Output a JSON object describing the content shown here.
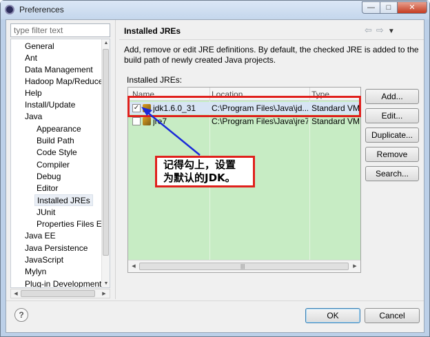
{
  "window": {
    "title": "Preferences",
    "min_glyph": "—",
    "max_glyph": "□",
    "close_glyph": "✕"
  },
  "left": {
    "filter_placeholder": "type filter text",
    "tree": [
      "General",
      "Ant",
      "Data Management",
      "Hadoop Map/Reduce",
      "Help",
      "Install/Update",
      "Java",
      "Appearance",
      "Build Path",
      "Code Style",
      "Compiler",
      "Debug",
      "Editor",
      "Installed JREs",
      "JUnit",
      "Properties Files Ed",
      "Java EE",
      "Java Persistence",
      "JavaScript",
      "Mylyn",
      "Plug-in Development"
    ],
    "selected": "Installed JREs"
  },
  "page": {
    "title": "Installed JREs",
    "description": "Add, remove or edit JRE definitions. By default, the checked JRE is added to the build path of newly created Java projects.",
    "table_label": "Installed JREs:",
    "columns": [
      "Name",
      "Location",
      "Type"
    ],
    "rows": [
      {
        "checked": true,
        "name": "jdk1.6.0_31",
        "location": "C:\\Program Files\\Java\\jd...",
        "type": "Standard VM"
      },
      {
        "checked": false,
        "name": "jre7",
        "location": "C:\\Program Files\\Java\\jre7",
        "type": "Standard VM"
      }
    ],
    "buttons": {
      "add": "Add...",
      "edit": "Edit...",
      "duplicate": "Duplicate...",
      "remove": "Remove",
      "search": "Search..."
    }
  },
  "annotation": {
    "line1": "记得勾上，设置",
    "line2": "为默认的JDK。",
    "color": "#e0201c",
    "arrow_color": "#1a2ad8"
  },
  "footer": {
    "help_glyph": "?",
    "ok": "OK",
    "cancel": "Cancel"
  }
}
